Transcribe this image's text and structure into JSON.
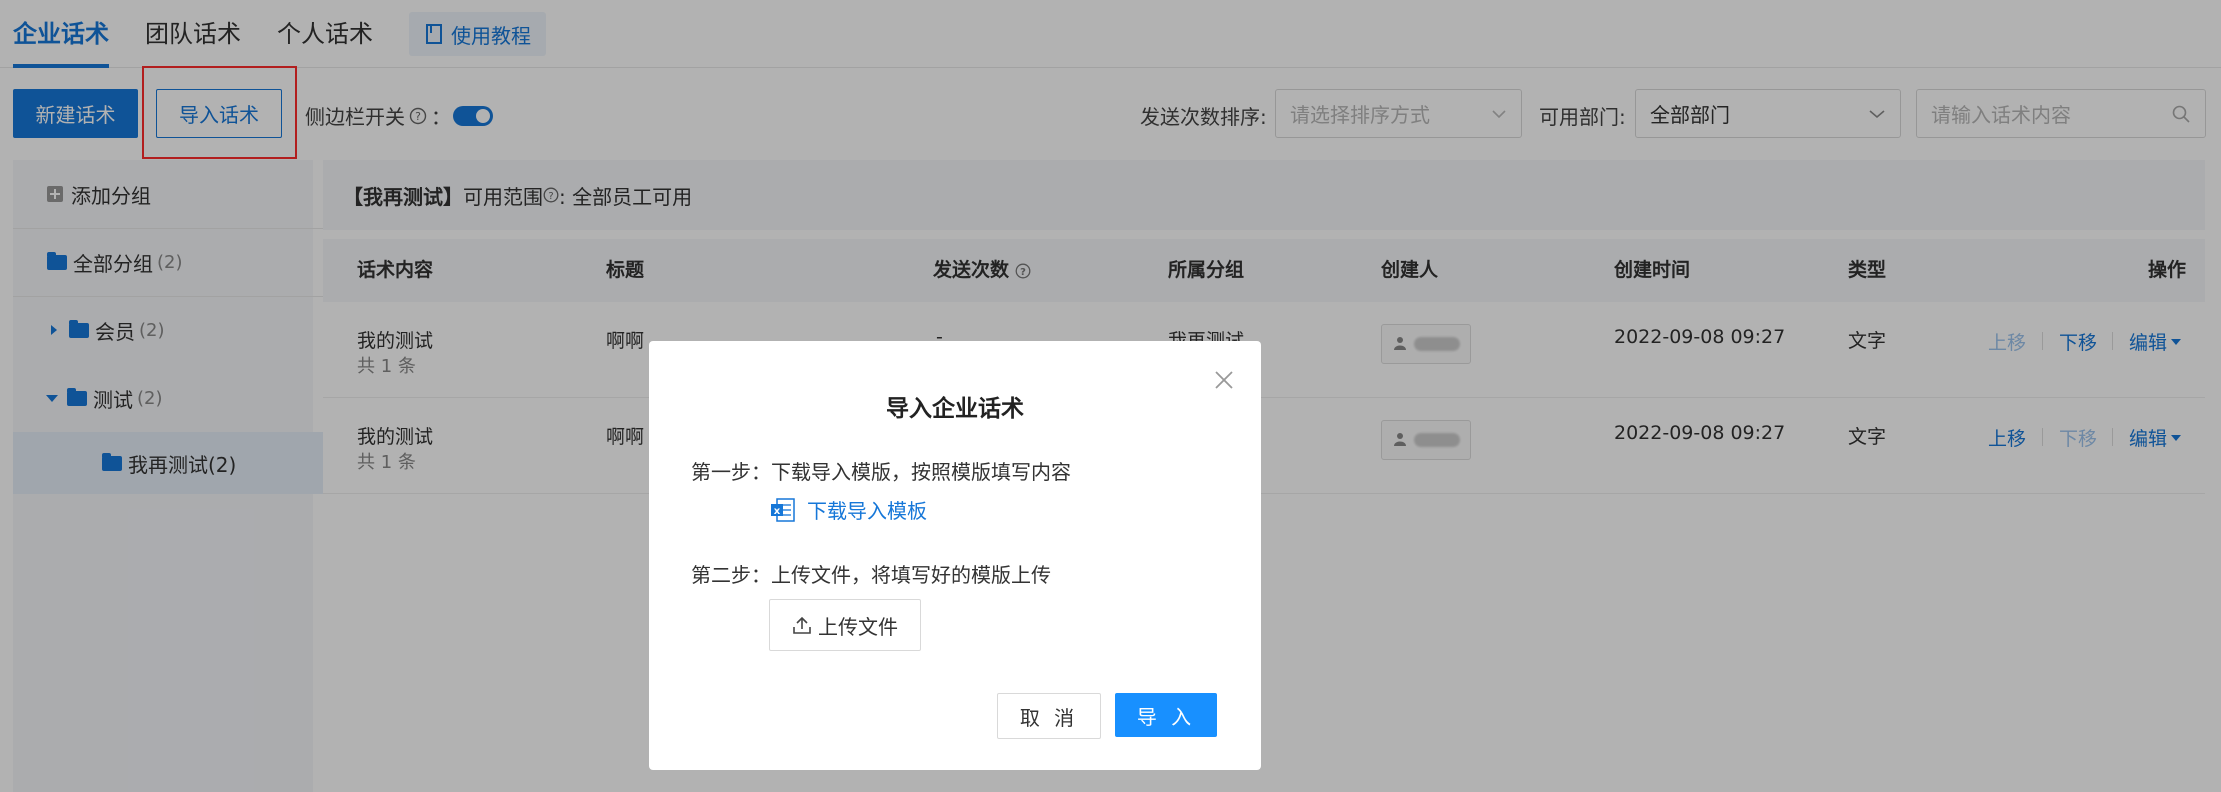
{
  "tabs": [
    {
      "label": "企业话术",
      "active": true
    },
    {
      "label": "团队话术",
      "active": false
    },
    {
      "label": "个人话术",
      "active": false
    }
  ],
  "guide_label": "使用教程",
  "toolbar": {
    "new_label": "新建话术",
    "import_label": "导入话术",
    "sidebar_toggle_label": "侧边栏开关",
    "sidebar_toggle_suffix": "：",
    "sort_label": "发送次数排序:",
    "sort_placeholder": "请选择排序方式",
    "dept_label": "可用部门:",
    "dept_value": "全部部门",
    "search_placeholder": "请输入话术内容"
  },
  "sidebar": {
    "add_group": "添加分组",
    "groups": [
      {
        "label": "全部分组",
        "count": "(2)"
      },
      {
        "label": "会员",
        "count": "(2)"
      },
      {
        "label": "测试",
        "count": "(2)"
      },
      {
        "label": "我再测试(2)",
        "count": ""
      }
    ]
  },
  "info": {
    "group_name": "【我再测试】",
    "scope_label": "可用范围",
    "scope_value": ": 全部员工可用"
  },
  "table": {
    "headers": [
      "话术内容",
      "标题",
      "发送次数",
      "所属分组",
      "创建人",
      "创建时间",
      "类型",
      "操作"
    ],
    "rows": [
      {
        "content": "我的测试",
        "sub": "共 1 条",
        "title": "啊啊",
        "count": "-",
        "group": "我再测试",
        "time": "2022-09-08 09:27",
        "type": "文字",
        "ops": [
          "上移",
          "下移",
          "编辑"
        ]
      },
      {
        "content": "我的测试",
        "sub": "共 1 条",
        "title": "啊啊",
        "count": "",
        "group": "",
        "time": "2022-09-08 09:27",
        "type": "文字",
        "ops": [
          "上移",
          "下移",
          "编辑"
        ]
      }
    ]
  },
  "modal": {
    "title": "导入企业话术",
    "step1": "第一步：下载导入模版，按照模版填写内容",
    "download_link": "下载导入模板",
    "step2": "第二步：上传文件，将填写好的模版上传",
    "upload_label": "上传文件",
    "cancel_label": "取 消",
    "ok_label": "导 入"
  },
  "colors": {
    "accent": "#1677d8",
    "primary": "#1890ff",
    "highlight": "#ff2b2b"
  }
}
